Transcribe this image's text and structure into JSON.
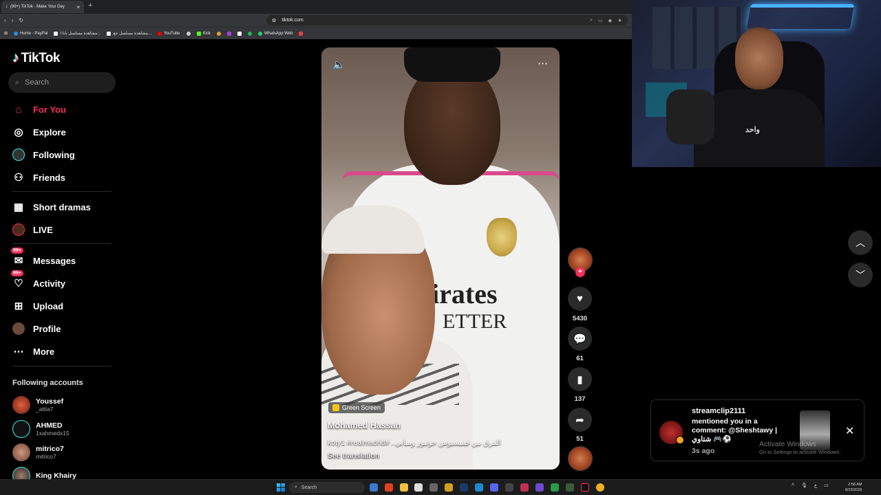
{
  "browser": {
    "tab_title": "(99+) TikTok - Make Your Day",
    "url": "tiktok.com",
    "bookmarks": [
      {
        "label": "Home - PayPal"
      },
      {
        "label": "مشاهدة مسلسل بابا ا..."
      },
      {
        "label": "مشاهدة مسلسل جع..."
      },
      {
        "label": "YouTube"
      },
      {
        "label": ""
      },
      {
        "label": "Kick"
      },
      {
        "label": "WhatsApp Web"
      }
    ]
  },
  "tiktok": {
    "logo_text": "TikTok",
    "search_placeholder": "Search",
    "nav": [
      {
        "label": "For You",
        "icon": "home-icon"
      },
      {
        "label": "Explore",
        "icon": "compass-icon"
      },
      {
        "label": "Following",
        "icon": "following-icon"
      },
      {
        "label": "Friends",
        "icon": "friends-icon"
      },
      {
        "label": "Short dramas",
        "icon": "film-icon"
      },
      {
        "label": "LIVE",
        "icon": "live-icon"
      },
      {
        "label": "Messages",
        "icon": "messages-icon",
        "badge": "99+"
      },
      {
        "label": "Activity",
        "icon": "activity-icon",
        "badge": "99+"
      },
      {
        "label": "Upload",
        "icon": "upload-icon"
      },
      {
        "label": "Profile",
        "icon": "profile-icon"
      },
      {
        "label": "More",
        "icon": "more-icon"
      }
    ],
    "following_title": "Following accounts",
    "accounts": [
      {
        "name": "Youssef",
        "handle": "_attia7"
      },
      {
        "name": "AHMED",
        "handle": "1xahmedx15"
      },
      {
        "name": "mitrico7",
        "handle": "mitrico7"
      },
      {
        "name": "King Khairy",
        "handle": ""
      }
    ]
  },
  "video": {
    "sponsor_line1": "irates",
    "sponsor_line2": "ETTER",
    "effect_label": "Green Screen",
    "author": "Mohamed Hassan",
    "description": "الفرق بين فينيسيوس جونيور ومبابي.. #koty1 #realmadrid",
    "see_translation": "See translation"
  },
  "actions": {
    "likes": "5430",
    "comments": "61",
    "saves": "137",
    "shares": "51"
  },
  "webcam": {
    "shirt_text": "واحد"
  },
  "notification": {
    "user": "streamclip2111",
    "message": "mentioned you in a comment: @Sheshtawy | شتاوي 🎮⚽",
    "time": "3s ago"
  },
  "watermark": {
    "line1": "Activate Windows",
    "line2": "Go to Settings to activate Windows."
  },
  "taskbar": {
    "search_label": "Search",
    "time": "2:58 AM",
    "date": "8/23/2026"
  }
}
